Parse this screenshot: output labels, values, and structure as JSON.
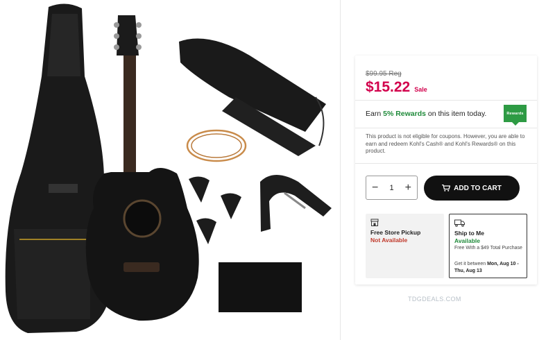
{
  "pricing": {
    "regular": "$99.95 Reg",
    "sale_price": "$15.22",
    "sale_label": "Sale"
  },
  "rewards": {
    "prefix": "Earn ",
    "highlight": "5% Rewards",
    "suffix": " on this item today.",
    "badge_text": "Rewards",
    "badge_color": "#2e9b44"
  },
  "coupon_note": "This product is not eligible for coupons. However, you are able to earn and redeem Kohl's Cash® and Kohl's Rewards® on this product.",
  "quantity": {
    "minus": "−",
    "value": "1",
    "plus": "+"
  },
  "cart_button": {
    "label": "ADD TO CART"
  },
  "fulfillment": {
    "pickup": {
      "title": "Free Store Pickup",
      "status": "Not Available"
    },
    "ship": {
      "title": "Ship to Me",
      "status": "Available",
      "detail": "Free With a $49 Total Purchase",
      "eta_prefix": "Get it between ",
      "eta_dates": "Mon, Aug 10 - Thu, Aug 13"
    }
  },
  "watermark": "TDGDEALS.COM",
  "icons": {
    "store": "store-icon",
    "truck": "truck-icon",
    "cart": "cart-icon"
  },
  "colors": {
    "price": "#d2004c",
    "rewards_green": "#1f8a3a",
    "not_available": "#c0392b",
    "button": "#111111"
  }
}
